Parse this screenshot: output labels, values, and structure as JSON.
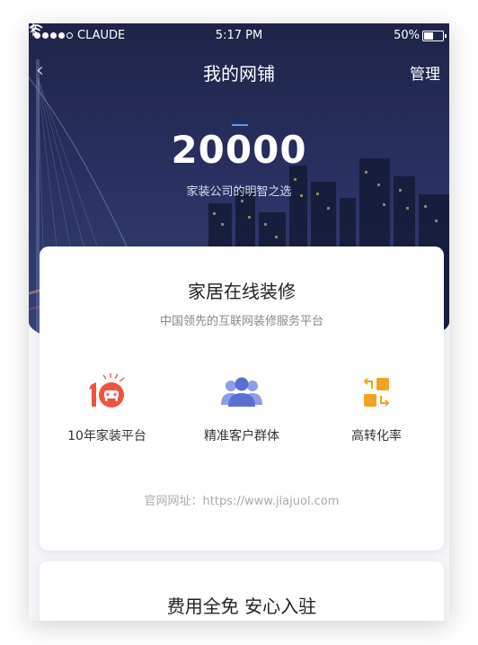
{
  "status": {
    "carrier": "CLAUDE",
    "time": "5:17 PM",
    "battery": "50%"
  },
  "nav": {
    "back_icon": "chevron-left-icon",
    "title": "我的网铺",
    "manage": "管理"
  },
  "hero": {
    "number": "20000",
    "slogan": "家装公司的明智之选"
  },
  "card1": {
    "title": "家居在线装修",
    "subtitle": "中国领先的互联网装修服务平台",
    "features": [
      {
        "icon": "ten-years-badge-icon",
        "label": "10年家装平台"
      },
      {
        "icon": "user-group-icon",
        "label": "精准客户群体"
      },
      {
        "icon": "conversion-arrows-icon",
        "label": "高转化率"
      }
    ],
    "website": "官网网址：https://www.jiajuol.com"
  },
  "card2": {
    "title": "费用全免  安心入驻"
  },
  "colors": {
    "hero_dark": "#1e2447",
    "accent_blue": "#5b6fd0",
    "accent_red": "#f0533d",
    "accent_orange": "#f3a323"
  }
}
